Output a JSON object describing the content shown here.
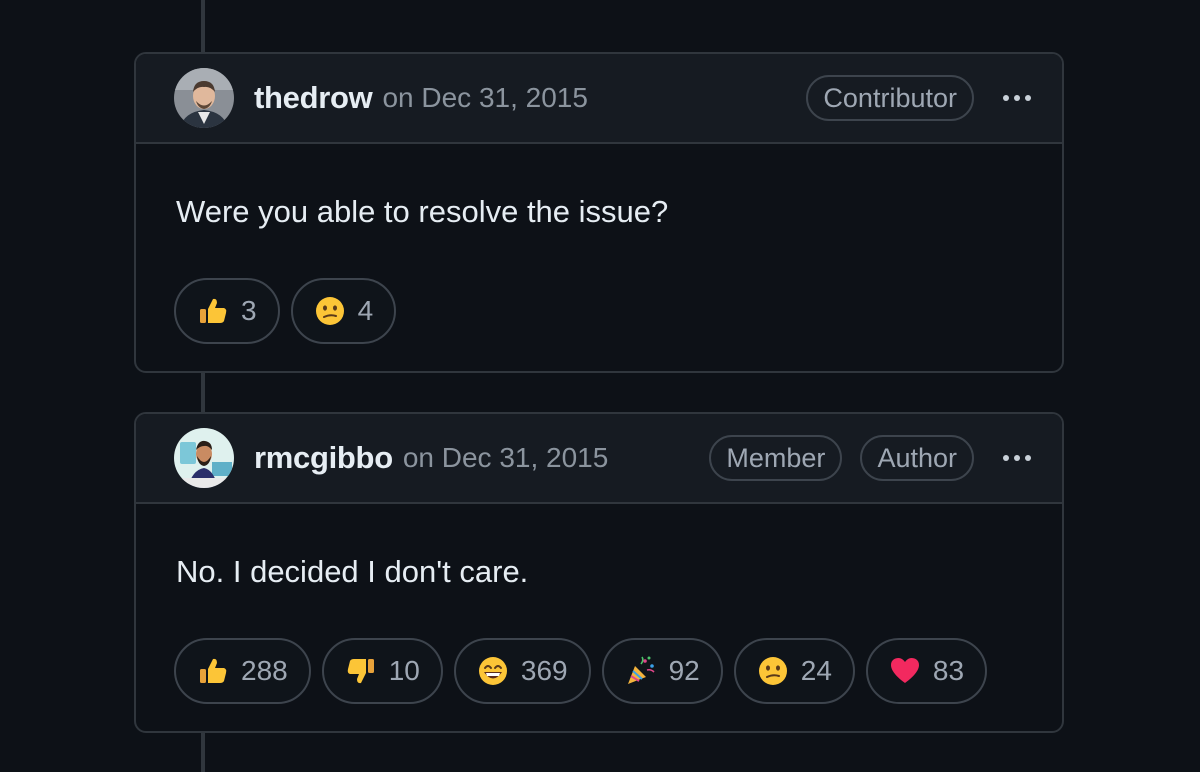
{
  "comments": [
    {
      "author": "thedrow",
      "date": "on Dec 31, 2015",
      "badges": [
        "Contributor"
      ],
      "body": "Were you able to resolve the issue?",
      "reactions": [
        {
          "icon": "thumbs-up-icon",
          "count": "3"
        },
        {
          "icon": "confused-icon",
          "count": "4"
        }
      ]
    },
    {
      "author": "rmcgibbo",
      "date": "on Dec 31, 2015",
      "badges": [
        "Member",
        "Author"
      ],
      "body": "No. I decided I don't care.",
      "reactions": [
        {
          "icon": "thumbs-up-icon",
          "count": "288"
        },
        {
          "icon": "thumbs-down-icon",
          "count": "10"
        },
        {
          "icon": "laugh-icon",
          "count": "369"
        },
        {
          "icon": "hooray-icon",
          "count": "92"
        },
        {
          "icon": "confused-icon",
          "count": "24"
        },
        {
          "icon": "heart-icon",
          "count": "83"
        }
      ]
    }
  ],
  "colors": {
    "background": "#0d1117",
    "header": "#161b22",
    "border": "#30363d",
    "muted_text": "#8b949e"
  }
}
